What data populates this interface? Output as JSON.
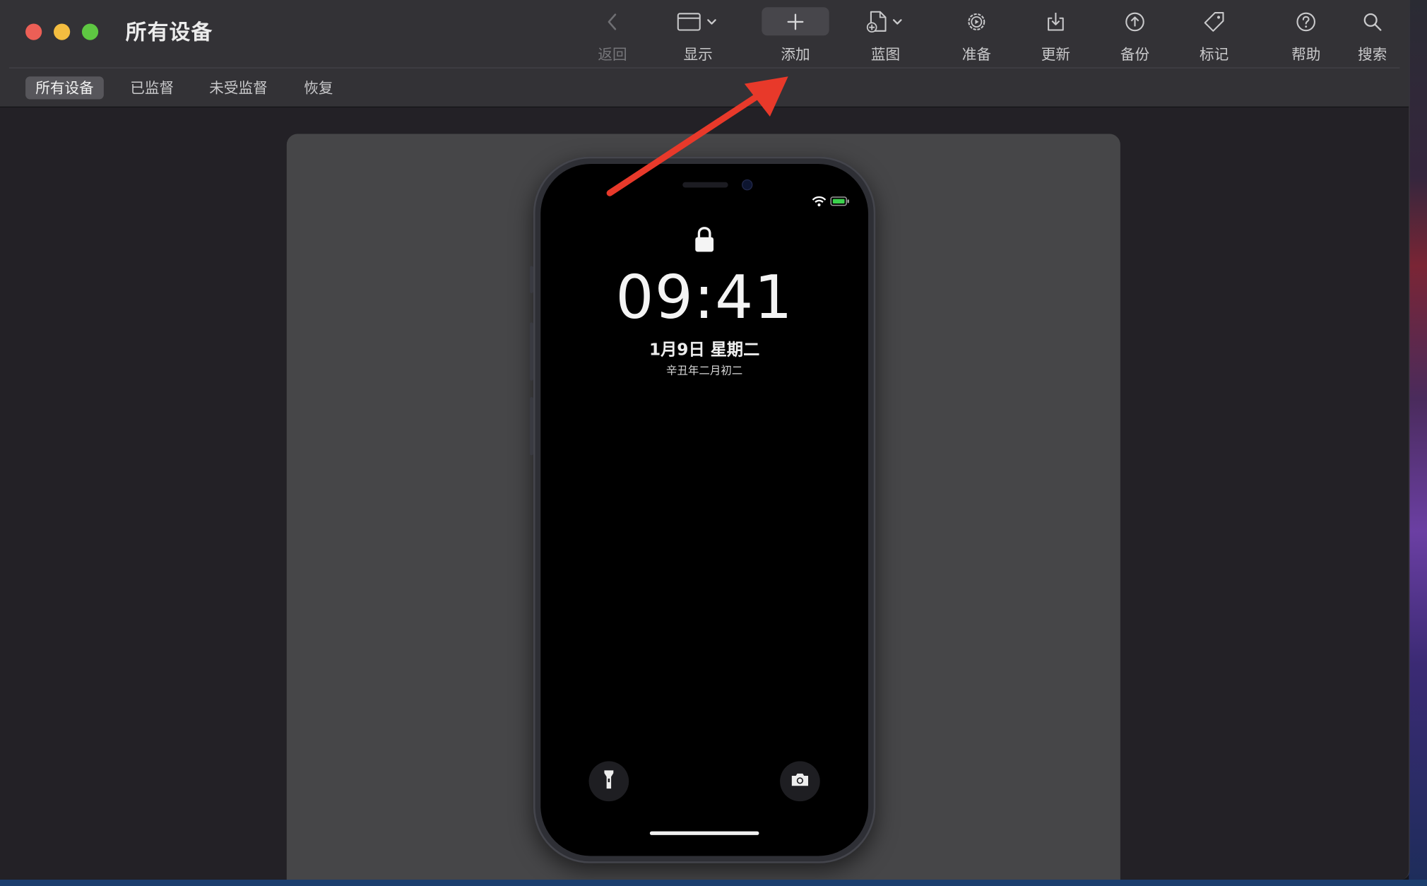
{
  "window": {
    "title": "所有设备"
  },
  "toolbar": {
    "items": [
      {
        "label": "返回",
        "icon": "chevron-left-icon",
        "enabled": false
      },
      {
        "label": "显示",
        "icon": "window-icon"
      },
      {
        "label": "添加",
        "icon": "plus-icon",
        "active": true
      },
      {
        "label": "蓝图",
        "icon": "blueprint-doc-icon"
      },
      {
        "label": "准备",
        "icon": "gear-icon"
      },
      {
        "label": "更新",
        "icon": "download-tray-icon"
      },
      {
        "label": "备份",
        "icon": "upload-circle-icon"
      },
      {
        "label": "标记",
        "icon": "tag-icon"
      },
      {
        "label": "帮助",
        "icon": "question-circle-icon"
      },
      {
        "label": "搜索",
        "icon": "search-icon"
      }
    ]
  },
  "tabs": [
    {
      "label": "所有设备",
      "active": true
    },
    {
      "label": "已监督"
    },
    {
      "label": "未受监督"
    },
    {
      "label": "恢复"
    }
  ],
  "device": {
    "lock_icon": "lock-icon",
    "time": "09:41",
    "date": "1月9日 星期二",
    "lunar_date": "辛丑年二月初二",
    "status_icons": [
      "wifi-icon",
      "battery-icon"
    ],
    "bottom_left": "flashlight-icon",
    "bottom_right": "camera-icon"
  },
  "annotation": {
    "arrow_color": "#e8392a"
  },
  "colors": {
    "window_bg": "#232126",
    "toolbar_bg": "#333236",
    "panel_bg": "#464648",
    "close": "#ec5f56",
    "minimize": "#f4bd40",
    "zoom": "#5ec742"
  }
}
